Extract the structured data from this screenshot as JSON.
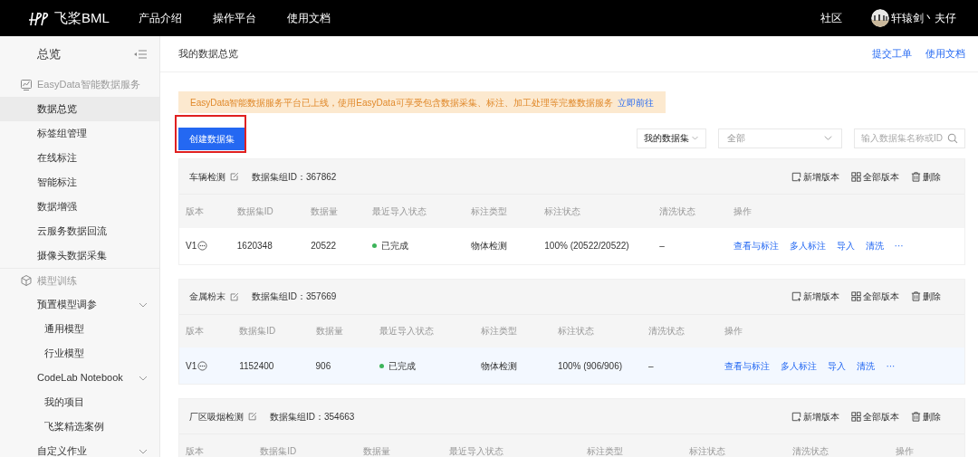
{
  "top_nav": {
    "logo_text": "飞桨BML",
    "items": [
      "产品介绍",
      "操作平台",
      "使用文档"
    ],
    "community": "社区",
    "user": "轩辕剑丶夫仔"
  },
  "sidebar": {
    "title": "总览",
    "sections": [
      {
        "label": "EasyData智能数据服务",
        "items": [
          {
            "label": "数据总览",
            "selected": true
          },
          {
            "label": "标签组管理",
            "selected": false
          },
          {
            "label": "在线标注",
            "selected": false
          },
          {
            "label": "智能标注",
            "selected": false
          },
          {
            "label": "数据增强",
            "selected": false
          },
          {
            "label": "云服务数据回流",
            "selected": false
          },
          {
            "label": "摄像头数据采集",
            "selected": false
          }
        ]
      },
      {
        "label": "模型训练",
        "items": [
          {
            "label": "预置模型调参",
            "selected": false,
            "kind": "group",
            "children": [
              {
                "label": "通用模型",
                "selected": false
              },
              {
                "label": "行业模型",
                "selected": false
              }
            ]
          },
          {
            "label": "CodeLab Notebook",
            "selected": false,
            "kind": "group",
            "children": [
              {
                "label": "我的项目",
                "selected": false
              },
              {
                "label": "飞桨精选案例",
                "selected": false
              }
            ]
          },
          {
            "label": "自定义作业",
            "selected": false,
            "kind": "group"
          }
        ]
      }
    ]
  },
  "page": {
    "title": "我的数据总览",
    "links": [
      "提交工单",
      "使用文档"
    ]
  },
  "banner": {
    "text": "EasyData智能数据服务平台已上线，使用EasyData可享受包含数据采集、标注、加工处理等完整数据服务",
    "link": "立即前往"
  },
  "create_button": {
    "label": "创建数据集",
    "highlighted": true
  },
  "filters": {
    "scope": "我的数据集",
    "type": "全部",
    "search_placeholder": "输入数据集名称或ID"
  },
  "datasets": [
    {
      "name": "车辆检测",
      "group_id": "数据集组ID：367862",
      "actions": [
        "新增版本",
        "全部版本",
        "删除"
      ],
      "columns": [
        "版本",
        "数据集ID",
        "数据量",
        "最近导入状态",
        "标注类型",
        "标注状态",
        "清洗状态",
        "操作"
      ],
      "hovered": false,
      "rows": [
        {
          "version": "V1",
          "dataset_id": "1620348",
          "count": "20522",
          "import_status": "已完成",
          "label_type": "物体检测",
          "label_status": "100% (20522/20522)",
          "clean_status": "–",
          "ops": [
            "查看与标注",
            "多人标注",
            "导入",
            "清洗",
            "···"
          ]
        }
      ]
    },
    {
      "name": "金属粉末",
      "group_id": "数据集组ID：357669",
      "actions": [
        "新增版本",
        "全部版本",
        "删除"
      ],
      "columns": [
        "版本",
        "数据集ID",
        "数据量",
        "最近导入状态",
        "标注类型",
        "标注状态",
        "清洗状态",
        "操作"
      ],
      "hovered": true,
      "rows": [
        {
          "version": "V1",
          "dataset_id": "1152400",
          "count": "906",
          "import_status": "已完成",
          "label_type": "物体检测",
          "label_status": "100% (906/906)",
          "clean_status": "–",
          "ops": [
            "查看与标注",
            "多人标注",
            "导入",
            "清洗",
            "···"
          ]
        }
      ]
    },
    {
      "name": "厂区吸烟检测",
      "group_id": "数据集组ID：354663",
      "actions": [
        "新增版本",
        "全部版本",
        "删除"
      ],
      "columns": [
        "版本",
        "数据集ID",
        "数据量",
        "最近导入状态",
        "标注类型",
        "标注状态",
        "清洗状态",
        "操作"
      ]
    }
  ]
}
